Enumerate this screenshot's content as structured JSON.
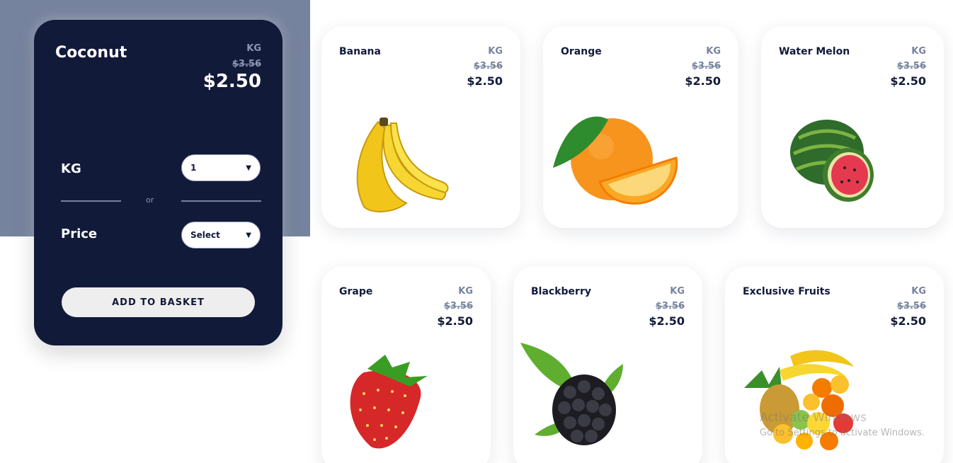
{
  "detail": {
    "name": "Coconut",
    "unit": "KG",
    "old_price": "$3.56",
    "price": "$2.50",
    "kg_label": "KG",
    "kg_value": "1",
    "or_text": "or",
    "price_label": "Price",
    "price_select": "Select",
    "button": "ADD TO BASKET"
  },
  "products": [
    {
      "name": "Banana",
      "unit": "KG",
      "old_price": "$3.56",
      "price": "$2.50"
    },
    {
      "name": "Orange",
      "unit": "KG",
      "old_price": "$3.56",
      "price": "$2.50"
    },
    {
      "name": "Water Melon",
      "unit": "KG",
      "old_price": "$3.56",
      "price": "$2.50"
    },
    {
      "name": "Grape",
      "unit": "KG",
      "old_price": "$3.56",
      "price": "$2.50"
    },
    {
      "name": "Blackberry",
      "unit": "KG",
      "old_price": "$3.56",
      "price": "$2.50"
    },
    {
      "name": "Exclusive Fruits",
      "unit": "KG",
      "old_price": "$3.56",
      "price": "$2.50"
    }
  ],
  "watermark": {
    "line1": "Activate Windows",
    "line2": "Go to Settings to activate Windows."
  },
  "colors": {
    "navy": "#121a3a",
    "slate": "#76839f",
    "button_bg": "#eeeeee"
  }
}
